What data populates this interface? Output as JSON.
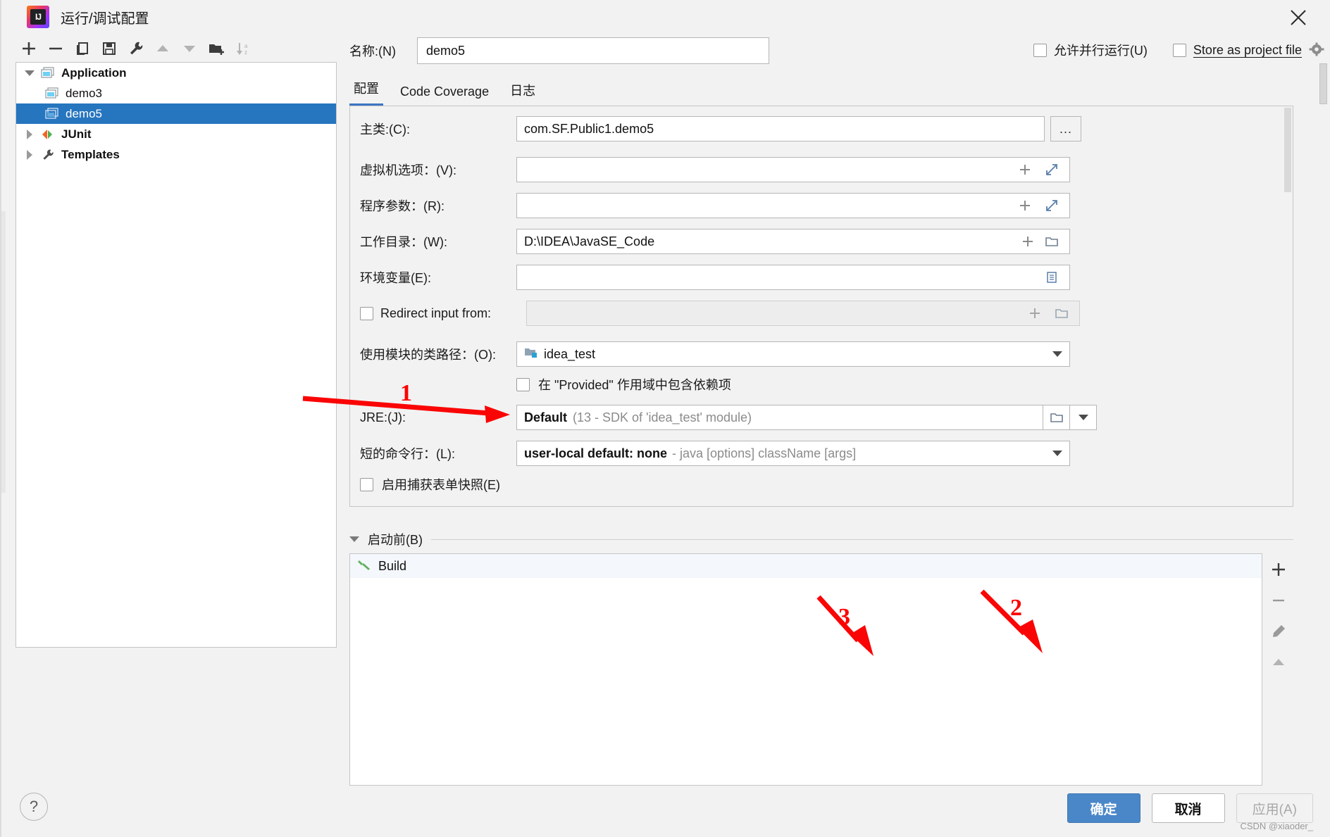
{
  "window": {
    "title": "运行/调试配置",
    "logo_text": "IJ",
    "close_icon": "close-icon"
  },
  "left_toolbar": {
    "buttons": [
      {
        "name": "add-button",
        "icon": "plus-icon"
      },
      {
        "name": "remove-button",
        "icon": "minus-icon"
      },
      {
        "name": "copy-button",
        "icon": "copy-icon"
      },
      {
        "name": "save-button",
        "icon": "save-icon"
      },
      {
        "name": "edit-templates-button",
        "icon": "wrench-icon"
      },
      {
        "name": "move-up-button",
        "icon": "arrow-up-icon"
      },
      {
        "name": "move-down-button",
        "icon": "arrow-down-icon"
      },
      {
        "name": "new-folder-button",
        "icon": "folder-add-icon"
      },
      {
        "name": "sort-button",
        "icon": "sort-az-icon"
      }
    ]
  },
  "tree": {
    "items": [
      {
        "label": "Application",
        "icon": "application-icon",
        "twisty": "expanded",
        "depth": 0,
        "bold": true,
        "selected": false
      },
      {
        "label": "demo3",
        "icon": "application-icon",
        "twisty": "none",
        "depth": 1,
        "bold": false,
        "selected": false
      },
      {
        "label": "demo5",
        "icon": "application-icon",
        "twisty": "none",
        "depth": 1,
        "bold": false,
        "selected": true
      },
      {
        "label": "JUnit",
        "icon": "junit-icon",
        "twisty": "collapsed",
        "depth": 0,
        "bold": true,
        "selected": false
      },
      {
        "label": "Templates",
        "icon": "wrench-icon",
        "twisty": "collapsed",
        "depth": 0,
        "bold": true,
        "selected": false
      }
    ]
  },
  "name_row": {
    "label": "名称:(N)",
    "value": "demo5",
    "placeholder": ""
  },
  "top_checks": {
    "allow_parallel": {
      "label": "允许并行运行(U)",
      "checked": false
    },
    "store_as_project_file": {
      "label": "Store as project file",
      "checked": false
    },
    "gear_icon": "gear-icon"
  },
  "tabs": [
    {
      "label": "配置",
      "active": true
    },
    {
      "label": "Code Coverage",
      "active": false
    },
    {
      "label": "日志",
      "active": false
    }
  ],
  "form": {
    "main_class": {
      "label": "主类:(C):",
      "value": "com.SF.Public1.demo5",
      "browse_label": "..."
    },
    "vm_options": {
      "label": "虚拟机选项：(V):",
      "value": "",
      "icons": [
        "plus-icon",
        "expand-icon"
      ]
    },
    "program_args": {
      "label": "程序参数：(R):",
      "value": "",
      "icons": [
        "plus-icon",
        "expand-icon"
      ]
    },
    "working_dir": {
      "label": "工作目录：(W):",
      "value": "D:\\IDEA\\JavaSE_Code",
      "icons": [
        "plus-icon",
        "folder-icon"
      ]
    },
    "env_vars": {
      "label": "环境变量(E):",
      "value": "",
      "icons": [
        "list-icon"
      ]
    },
    "redirect_input": {
      "label": "Redirect input from:",
      "checked": false,
      "value": "",
      "icons": [
        "plus-icon",
        "folder-icon"
      ]
    },
    "module_classpath": {
      "label": "使用模块的类路径：(O):",
      "value": "idea_test",
      "icon": "module-icon"
    },
    "include_provided": {
      "label": "在 \"Provided\" 作用域中包含依赖项",
      "checked": false
    },
    "jre": {
      "label": "JRE:(J):",
      "value_bold": "Default",
      "value_gray": "(13 - SDK of 'idea_test' module)",
      "icons": [
        "folder-icon"
      ]
    },
    "shorten_command_line": {
      "label": "短的命令行：(L):",
      "value_bold": "user-local default: none",
      "value_gray": "- java [options] className [args]"
    },
    "capture_form_snapshots": {
      "label": "启用捕获表单快照(E)",
      "checked": false
    }
  },
  "before_launch": {
    "title": "启动前(B)",
    "items": [
      {
        "label": "Build",
        "icon": "build-hammer-icon"
      }
    ],
    "toolbar": [
      {
        "name": "bl-add-button",
        "icon": "plus-icon"
      },
      {
        "name": "bl-remove-button",
        "icon": "minus-icon"
      },
      {
        "name": "bl-edit-button",
        "icon": "pencil-icon"
      },
      {
        "name": "bl-move-up-button",
        "icon": "arrow-up-icon"
      }
    ]
  },
  "footer": {
    "help_label": "?",
    "ok_label": "确定",
    "cancel_label": "取消",
    "apply_label": "应用(A)",
    "apply_disabled": true
  },
  "annotations": [
    {
      "number": "1",
      "target": "jre-field"
    },
    {
      "number": "2",
      "target": "apply-button"
    },
    {
      "number": "3",
      "target": "ok-button"
    }
  ],
  "watermark": "CSDN @xiaoder_",
  "colors": {
    "accent": "#2675bf",
    "primary_button": "#4a87c8",
    "tab_underline": "#3c75c4",
    "annotation_red": "#fa0505"
  }
}
